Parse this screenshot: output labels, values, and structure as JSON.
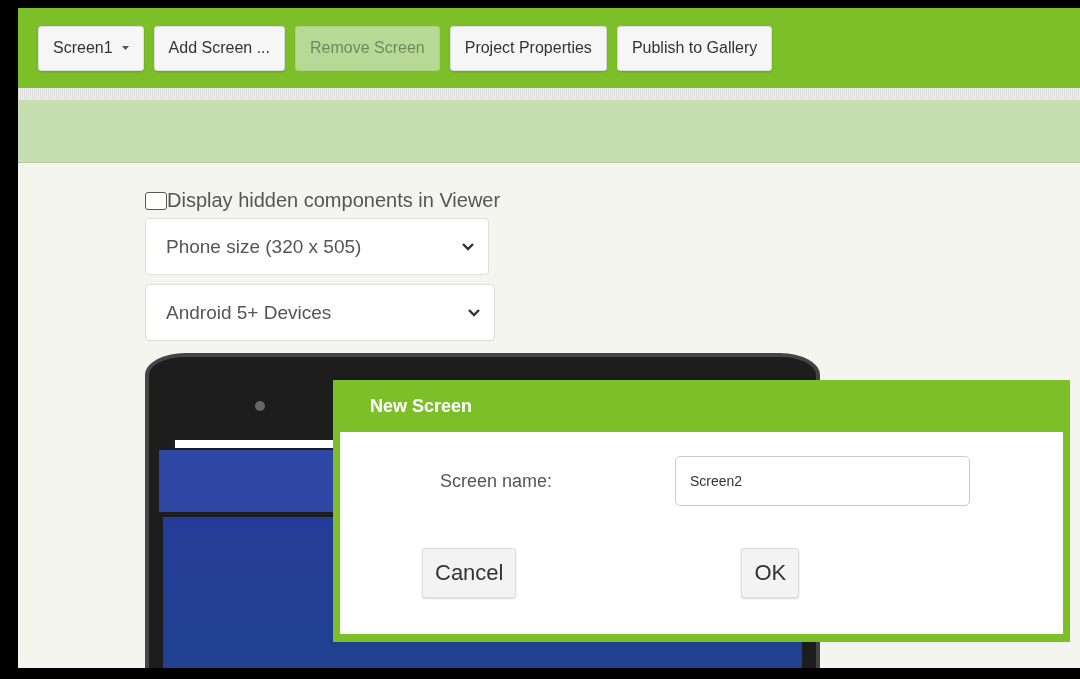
{
  "toolbar": {
    "buttons": [
      {
        "label": "Screen1",
        "kind": "dropdown",
        "disabled": false
      },
      {
        "label": "Add Screen ...",
        "kind": "button",
        "disabled": false
      },
      {
        "label": "Remove Screen",
        "kind": "button",
        "disabled": true
      },
      {
        "label": "Project Properties",
        "kind": "button",
        "disabled": false
      },
      {
        "label": "Publish to Gallery",
        "kind": "button",
        "disabled": false
      }
    ]
  },
  "viewer": {
    "hidden_components": {
      "label": "Display hidden components in Viewer",
      "checked": false
    },
    "selects": [
      {
        "value": "Phone size (320 x 505)"
      },
      {
        "value": "Android 5+ Devices"
      }
    ]
  },
  "dialog": {
    "title": "New Screen",
    "field_label": "Screen name:",
    "field_value": "Screen2",
    "buttons": [
      "Cancel",
      "OK"
    ]
  }
}
